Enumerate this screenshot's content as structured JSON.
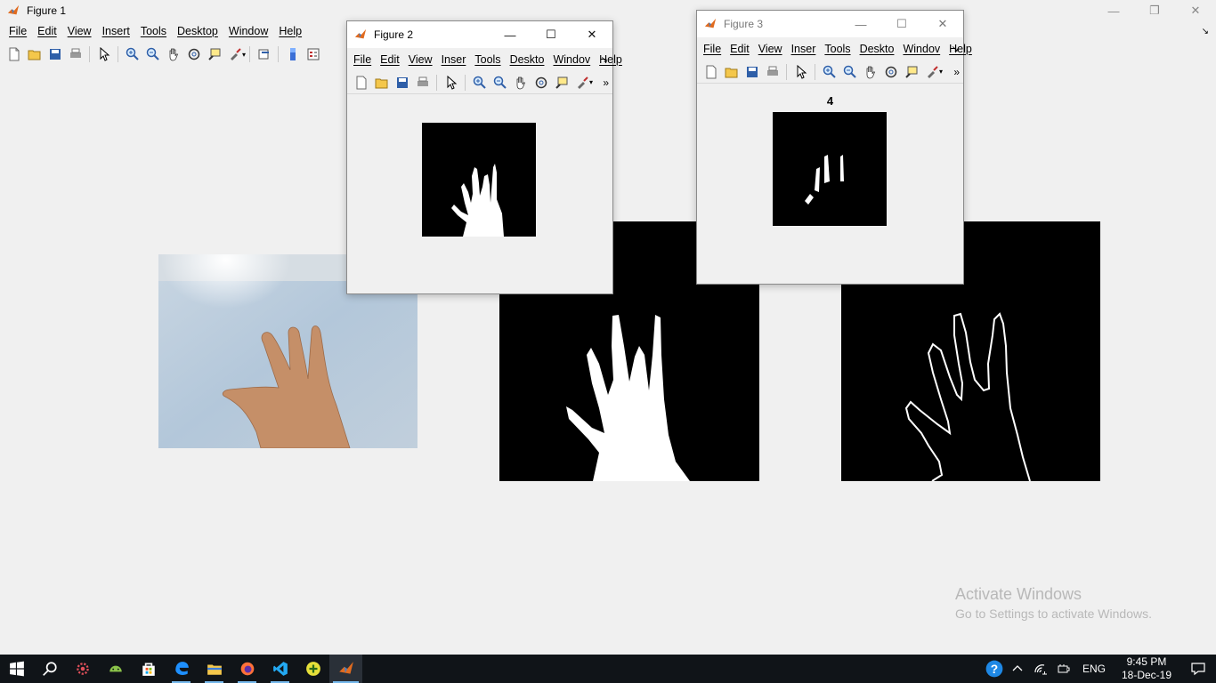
{
  "figure1": {
    "title": "Figure 1",
    "menu": [
      "File",
      "Edit",
      "View",
      "Insert",
      "Tools",
      "Desktop",
      "Window",
      "Help"
    ]
  },
  "figure2": {
    "title": "Figure 2",
    "menu": [
      "File",
      "Edit",
      "View",
      "Inser",
      "Tools",
      "Deskto",
      "Windov",
      "Help"
    ]
  },
  "figure3": {
    "title": "Figure 3",
    "menu": [
      "File",
      "Edit",
      "View",
      "Inser",
      "Tools",
      "Deskto",
      "Windov",
      "Help"
    ],
    "axes_title": "4"
  },
  "watermark": {
    "title": "Activate Windows",
    "subtitle": "Go to Settings to activate Windows."
  },
  "taskbar": {
    "language": "ENG",
    "time": "9:45 PM",
    "date": "18-Dec-19"
  },
  "colors": {
    "taskbar": "#101418",
    "accent": "#76b9ed",
    "figure_bg": "#f0f0f0"
  }
}
